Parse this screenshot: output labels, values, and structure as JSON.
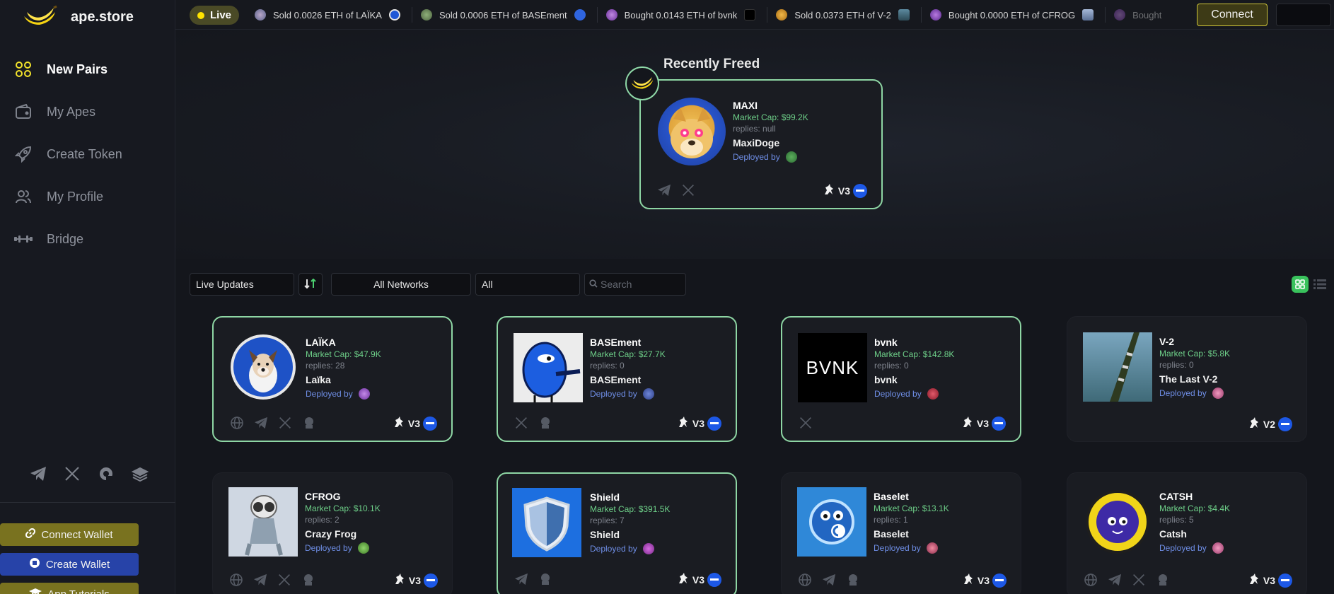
{
  "brand": {
    "name": "ape.store"
  },
  "sidebar": {
    "items": [
      {
        "label": "New Pairs",
        "icon": "grid-circles-icon",
        "active": true
      },
      {
        "label": "My Apes",
        "icon": "wallet-icon",
        "active": false
      },
      {
        "label": "Create Token",
        "icon": "rocket-icon",
        "active": false
      },
      {
        "label": "My Profile",
        "icon": "users-icon",
        "active": false
      },
      {
        "label": "Bridge",
        "icon": "bridge-icon",
        "active": false
      }
    ],
    "social_icons": [
      "telegram-icon",
      "x-icon",
      "chat-icon",
      "docs-icon"
    ],
    "connect_wallet": "Connect Wallet",
    "create_wallet": "Create Wallet",
    "app_tutorials": "App Tutorials"
  },
  "topbar": {
    "live": "Live",
    "ticker": [
      {
        "text": "Sold 0.0026 ETH of LAÏKA"
      },
      {
        "text": "Sold 0.0006 ETH of BASEment"
      },
      {
        "text": "Bought 0.0143 ETH of bvnk"
      },
      {
        "text": "Sold 0.0373 ETH of V-2"
      },
      {
        "text": "Bought 0.0000 ETH of CFROG"
      },
      {
        "text": "Bought"
      }
    ],
    "connect": "Connect"
  },
  "hero": {
    "title": "Recently Freed",
    "card": {
      "ticker": "MAXI",
      "market_cap": "Market Cap: $99.2K",
      "replies": "replies: null",
      "name": "MaxiDoge",
      "deployed": "Deployed by",
      "version": "V3"
    }
  },
  "filters": {
    "sort": "Live Updates",
    "network": "All Networks",
    "type": "All",
    "search_placeholder": "Search"
  },
  "cards": [
    {
      "ticker": "LAÏKA",
      "market_cap": "Market Cap: $47.9K",
      "replies": "replies: 28",
      "name": "Laïka",
      "deployed": "Deployed by",
      "version": "V3"
    },
    {
      "ticker": "BASEment",
      "market_cap": "Market Cap: $27.7K",
      "replies": "replies: 0",
      "name": "BASEment",
      "deployed": "Deployed by",
      "version": "V3"
    },
    {
      "ticker": "bvnk",
      "market_cap": "Market Cap: $142.8K",
      "replies": "replies: 0",
      "name": "bvnk",
      "deployed": "Deployed by",
      "version": "V3",
      "logo_text": "BVNK"
    },
    {
      "ticker": "V-2",
      "market_cap": "Market Cap: $5.8K",
      "replies": "replies: 0",
      "name": "The Last V-2",
      "deployed": "Deployed by",
      "version": "V2"
    },
    {
      "ticker": "CFROG",
      "market_cap": "Market Cap: $10.1K",
      "replies": "replies: 2",
      "name": "Crazy Frog",
      "deployed": "Deployed by",
      "version": "V3"
    },
    {
      "ticker": "Shield",
      "market_cap": "Market Cap: $391.5K",
      "replies": "replies: 7",
      "name": "Shield",
      "deployed": "Deployed by",
      "version": "V3"
    },
    {
      "ticker": "Baselet",
      "market_cap": "Market Cap: $13.1K",
      "replies": "replies: 1",
      "name": "Baselet",
      "deployed": "Deployed by",
      "version": "V3"
    },
    {
      "ticker": "CATSH",
      "market_cap": "Market Cap: $4.4K",
      "replies": "replies: 5",
      "name": "Catsh",
      "deployed": "Deployed by",
      "version": "V3"
    }
  ],
  "colors": {
    "accent_green": "#8ed6a4",
    "market_cap": "#6ed089",
    "deployer": "#6f8ee6",
    "eth_blue": "#1d58e6",
    "live_yellow": "#ffe300"
  }
}
